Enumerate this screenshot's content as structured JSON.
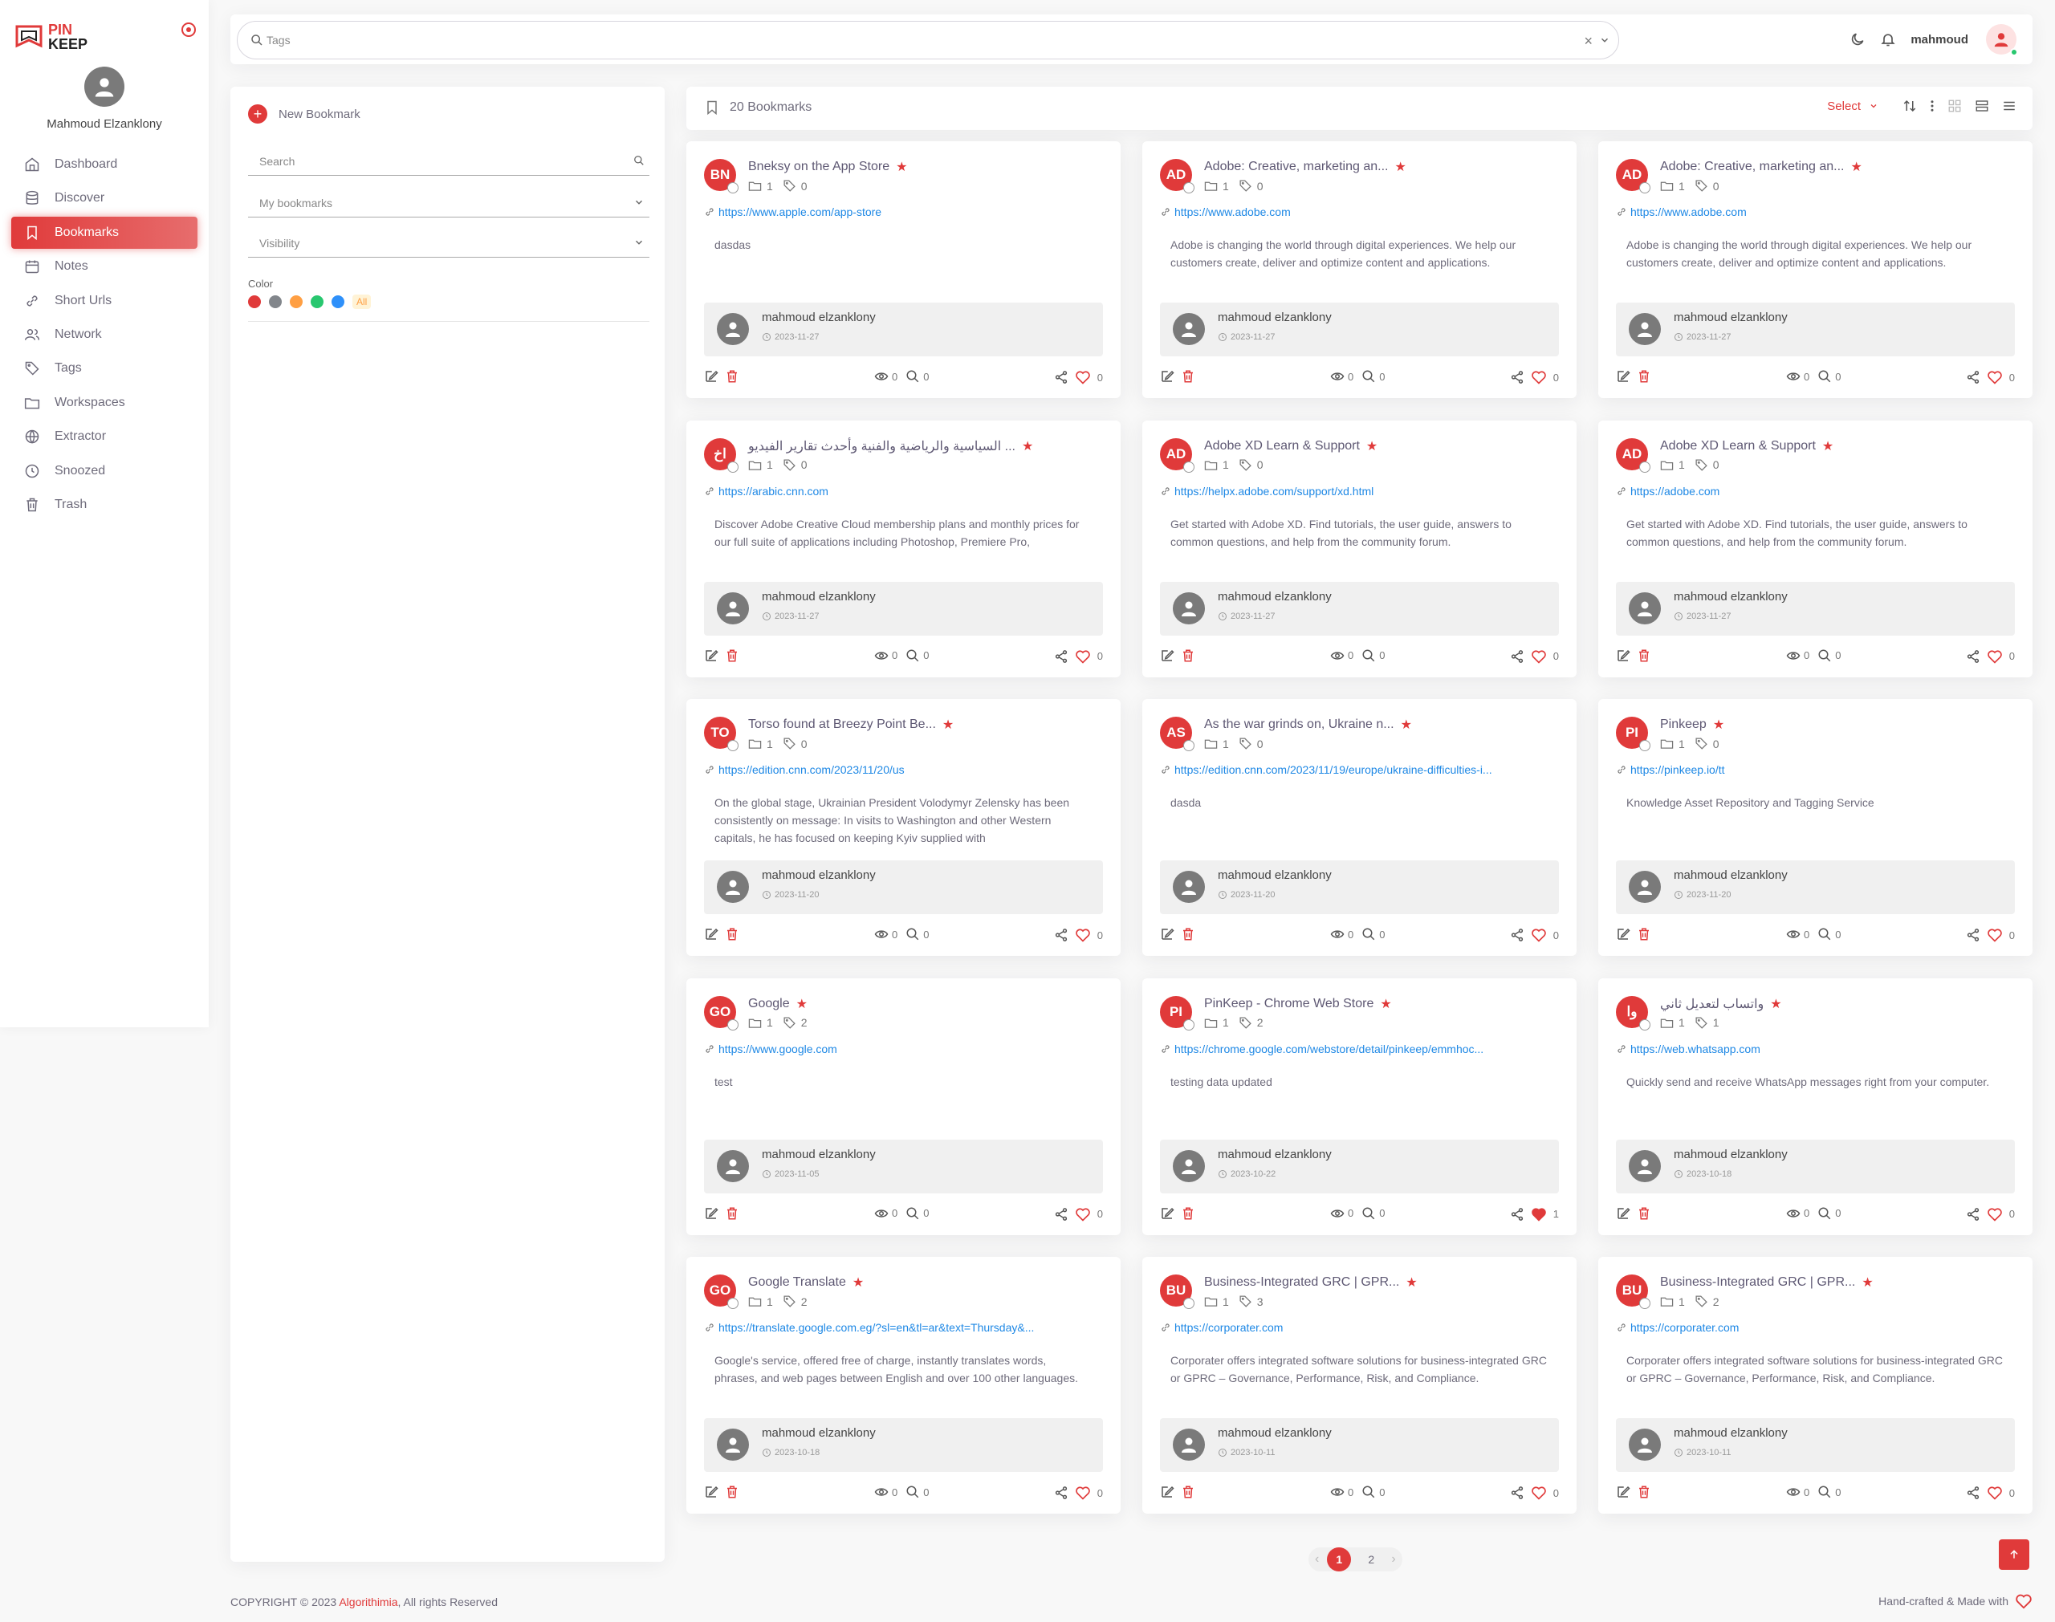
{
  "sidebar": {
    "logo_line1": "PIN",
    "logo_line2": "KEEP",
    "user_name": "Mahmoud Elzanklony",
    "items": [
      {
        "label": "Dashboard",
        "icon": "home-icon",
        "active": false
      },
      {
        "label": "Discover",
        "icon": "database-icon",
        "active": false
      },
      {
        "label": "Bookmarks",
        "icon": "bookmark-icon",
        "active": true
      },
      {
        "label": "Notes",
        "icon": "calendar-icon",
        "active": false
      },
      {
        "label": "Short Urls",
        "icon": "link-icon",
        "active": false
      },
      {
        "label": "Network",
        "icon": "users-icon",
        "active": false
      },
      {
        "label": "Tags",
        "icon": "tag-icon",
        "active": false
      },
      {
        "label": "Workspaces",
        "icon": "folder-icon",
        "active": false
      },
      {
        "label": "Extractor",
        "icon": "globe-icon",
        "active": false
      },
      {
        "label": "Snoozed",
        "icon": "clock-icon",
        "active": false
      },
      {
        "label": "Trash",
        "icon": "trash-icon",
        "active": false
      }
    ]
  },
  "topbar": {
    "tags_placeholder": "Tags",
    "clear_symbol": "×",
    "username": "mahmoud"
  },
  "filters": {
    "new_bookmark": "New Bookmark",
    "search_placeholder": "Search",
    "collection_value": "My bookmarks",
    "visibility_value": "Visibility",
    "color_label": "Color",
    "colors": [
      "#e03a3a",
      "#82868b",
      "#ff9f43",
      "#28c76f",
      "#2e90fa"
    ],
    "all_label": "All"
  },
  "header": {
    "count_label": "20 Bookmarks",
    "select_label": "Select"
  },
  "cards": [
    {
      "initials": "BN",
      "title": "Bneksy on the App Store",
      "folders": "1",
      "tags": "0",
      "url": "https://www.apple.com/app-store",
      "desc": "dasdas",
      "owner": "mahmoud elzanklony",
      "date": "2023-11-27",
      "views": "0",
      "searches": "0",
      "likes": "0",
      "liked": false
    },
    {
      "initials": "AD",
      "title": "Adobe: Creative, marketing an...",
      "folders": "1",
      "tags": "0",
      "url": "https://www.adobe.com",
      "desc": "Adobe is changing the world through digital experiences. We help our customers create, deliver and optimize content and applications.",
      "owner": "mahmoud elzanklony",
      "date": "2023-11-27",
      "views": "0",
      "searches": "0",
      "likes": "0",
      "liked": false
    },
    {
      "initials": "AD",
      "title": "Adobe: Creative, marketing an...",
      "folders": "1",
      "tags": "0",
      "url": "https://www.adobe.com",
      "desc": "Adobe is changing the world through digital experiences. We help our customers create, deliver and optimize content and applications.",
      "owner": "mahmoud elzanklony",
      "date": "2023-11-27",
      "views": "0",
      "searches": "0",
      "likes": "0",
      "liked": false
    },
    {
      "initials": "اخ",
      "title": "السياسية والرياضية والفنية وأحدث تقارير الفيديو ...",
      "folders": "1",
      "tags": "0",
      "url": "https://arabic.cnn.com",
      "desc": "Discover Adobe Creative Cloud membership plans and monthly prices for our\nfull suite of applications including Photoshop, Premiere Pro,",
      "owner": "mahmoud elzanklony",
      "date": "2023-11-27",
      "views": "0",
      "searches": "0",
      "likes": "0",
      "liked": false
    },
    {
      "initials": "AD",
      "title": "Adobe XD Learn & Support",
      "folders": "1",
      "tags": "0",
      "url": "https://helpx.adobe.com/support/xd.html",
      "desc": "Get started with Adobe XD. Find tutorials, the user guide, answers to common questions, and help from the community forum.",
      "owner": "mahmoud elzanklony",
      "date": "2023-11-27",
      "views": "0",
      "searches": "0",
      "likes": "0",
      "liked": false
    },
    {
      "initials": "AD",
      "title": "Adobe XD Learn & Support",
      "folders": "1",
      "tags": "0",
      "url": "https://adobe.com",
      "desc": "Get started with Adobe XD. Find tutorials, the user guide, answers to common questions, and help from the community forum.",
      "owner": "mahmoud elzanklony",
      "date": "2023-11-27",
      "views": "0",
      "searches": "0",
      "likes": "0",
      "liked": false
    },
    {
      "initials": "TO",
      "title": "Torso found at Breezy Point Be...",
      "folders": "1",
      "tags": "0",
      "url": "https://edition.cnn.com/2023/11/20/us",
      "desc": "On the global stage, Ukrainian President Volodymyr Zelensky has been consistently on message: In visits to Washington and other Western capitals, he has focused on keeping Kyiv supplied with",
      "owner": "mahmoud elzanklony",
      "date": "2023-11-20",
      "views": "0",
      "searches": "0",
      "likes": "0",
      "liked": false
    },
    {
      "initials": "AS",
      "title": "As the war grinds on, Ukraine n...",
      "folders": "1",
      "tags": "0",
      "url": "https://edition.cnn.com/2023/11/19/europe/ukraine-difficulties-i...",
      "desc": "dasda",
      "owner": "mahmoud elzanklony",
      "date": "2023-11-20",
      "views": "0",
      "searches": "0",
      "likes": "0",
      "liked": false
    },
    {
      "initials": "PI",
      "title": "Pinkeep",
      "folders": "1",
      "tags": "0",
      "url": "https://pinkeep.io/tt",
      "desc": "Knowledge Asset Repository and Tagging Service",
      "owner": "mahmoud elzanklony",
      "date": "2023-11-20",
      "views": "0",
      "searches": "0",
      "likes": "0",
      "liked": false
    },
    {
      "initials": "GO",
      "title": "Google",
      "folders": "1",
      "tags": "2",
      "url": "https://www.google.com",
      "desc": "test",
      "owner": "mahmoud elzanklony",
      "date": "2023-11-05",
      "views": "0",
      "searches": "0",
      "likes": "0",
      "liked": false
    },
    {
      "initials": "PI",
      "title": "PinKeep - Chrome Web Store",
      "folders": "1",
      "tags": "2",
      "url": "https://chrome.google.com/webstore/detail/pinkeep/emmhoc...",
      "desc": "testing data updated",
      "owner": "mahmoud elzanklony",
      "date": "2023-10-22",
      "views": "0",
      "searches": "0",
      "likes": "1",
      "liked": true
    },
    {
      "initials": "وا",
      "title": "واتساب لتعديل ثاني",
      "folders": "1",
      "tags": "1",
      "url": "https://web.whatsapp.com",
      "desc": "Quickly send and receive WhatsApp messages right from your computer.",
      "owner": "mahmoud elzanklony",
      "date": "2023-10-18",
      "views": "0",
      "searches": "0",
      "likes": "0",
      "liked": false
    },
    {
      "initials": "GO",
      "title": "Google Translate",
      "folders": "1",
      "tags": "2",
      "url": "https://translate.google.com.eg/?sl=en&tl=ar&text=Thursday&...",
      "desc": "Google's service, offered free of charge, instantly translates words, phrases, and web pages between English and over 100 other languages.",
      "owner": "mahmoud elzanklony",
      "date": "2023-10-18",
      "views": "0",
      "searches": "0",
      "likes": "0",
      "liked": false
    },
    {
      "initials": "BU",
      "title": "Business-Integrated GRC | GPR...",
      "folders": "1",
      "tags": "3",
      "url": "https://corporater.com",
      "desc": "Corporater offers integrated software solutions for business-integrated GRC or GPRC – Governance, Performance, Risk, and Compliance.",
      "owner": "mahmoud elzanklony",
      "date": "2023-10-11",
      "views": "0",
      "searches": "0",
      "likes": "0",
      "liked": false
    },
    {
      "initials": "BU",
      "title": "Business-Integrated GRC | GPR...",
      "folders": "1",
      "tags": "2",
      "url": "https://corporater.com",
      "desc": "Corporater offers integrated software solutions for business-integrated GRC or GPRC – Governance, Performance, Risk, and Compliance.",
      "owner": "mahmoud elzanklony",
      "date": "2023-10-11",
      "views": "0",
      "searches": "0",
      "likes": "0",
      "liked": false
    }
  ],
  "pagination": {
    "prev": "‹",
    "pages": [
      "1",
      "2"
    ],
    "next": "›",
    "active": "1"
  },
  "footer": {
    "copyright_prefix": "COPYRIGHT © 2023",
    "brand": "Algorithimia",
    "copyright_suffix": ", All rights Reserved",
    "made_with": "Hand-crafted & Made with"
  }
}
